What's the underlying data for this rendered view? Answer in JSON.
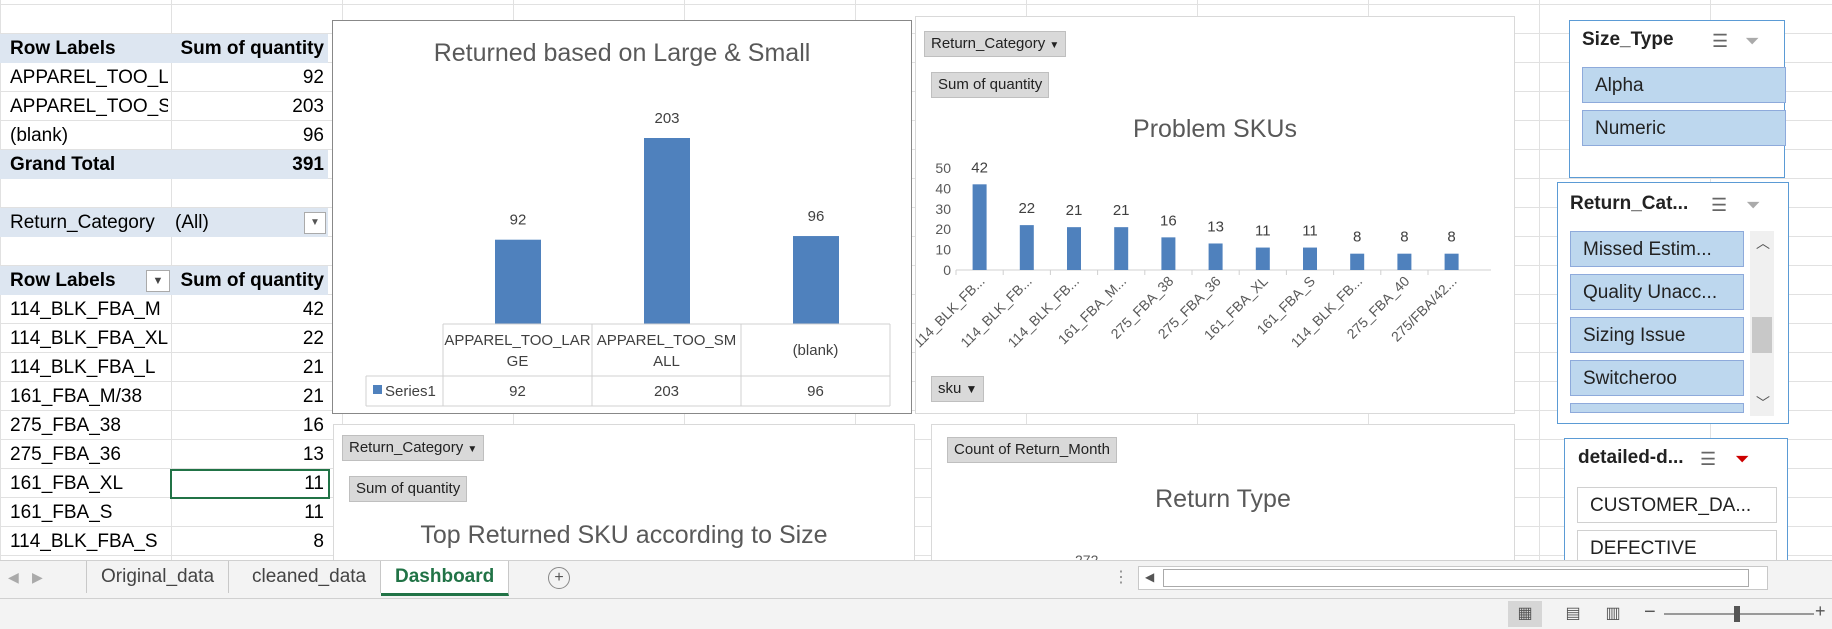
{
  "pivot1": {
    "headers": [
      "Row Labels",
      "Sum of quantity"
    ],
    "rows": [
      [
        "APPAREL_TOO_LARGE",
        "92"
      ],
      [
        "APPAREL_TOO_SMALL",
        "203"
      ],
      [
        "(blank)",
        "96"
      ]
    ],
    "total": [
      "Grand Total",
      "391"
    ]
  },
  "filter": {
    "label": "Return_Category",
    "value": "(All)"
  },
  "pivot2": {
    "headers": [
      "Row Labels",
      "Sum of quantity"
    ],
    "rows": [
      [
        "114_BLK_FBA_M",
        "42"
      ],
      [
        "114_BLK_FBA_XL",
        "22"
      ],
      [
        "114_BLK_FBA_L",
        "21"
      ],
      [
        "161_FBA_M/38",
        "21"
      ],
      [
        "275_FBA_38",
        "16"
      ],
      [
        "275_FBA_36",
        "13"
      ],
      [
        "161_FBA_XL",
        "11"
      ],
      [
        "161_FBA_S",
        "11"
      ],
      [
        "114_BLK_FBA_S",
        "8"
      ]
    ]
  },
  "chart1": {
    "title": "Returned based on Large & Small",
    "table_series": "Series1",
    "table_headers": [
      "APPAREL_TOO_LAR GE",
      "APPAREL_TOO_SM ALL",
      "(blank)"
    ],
    "color": "#4f81bd"
  },
  "chart2": {
    "title": "Problem SKUs",
    "filter_btn": "Return_Category",
    "values_btn": "Sum of quantity",
    "axis_btn": "sku",
    "yticks": [
      "50",
      "40",
      "30",
      "20",
      "10",
      "0"
    ],
    "color": "#4f81bd"
  },
  "chart3": {
    "title": "Top Returned SKU according to Size",
    "filter_btn": "Return_Category",
    "values_btn": "Sum of quantity"
  },
  "chart4": {
    "title": "Return Type",
    "values_btn": "Count of Return_Month",
    "partial_label": "272"
  },
  "slicer1": {
    "title": "Size_Type",
    "items": [
      "Alpha",
      "Numeric"
    ]
  },
  "slicer2": {
    "title": "Return_Cat...",
    "items": [
      "Missed Estim...",
      "Quality Unacc...",
      "Sizing Issue",
      "Switcheroo"
    ]
  },
  "slicer3": {
    "title": "detailed-d...",
    "items": [
      "CUSTOMER_DA...",
      "DEFECTIVE"
    ]
  },
  "tabs": [
    "Original_data",
    "cleaned_data",
    "Dashboard"
  ],
  "chart_data": [
    {
      "type": "bar",
      "title": "Returned based on Large & Small",
      "categories": [
        "APPAREL_TOO_LARGE",
        "APPAREL_TOO_SMALL",
        "(blank)"
      ],
      "series": [
        {
          "name": "Series1",
          "values": [
            92,
            203,
            96
          ]
        }
      ]
    },
    {
      "type": "bar",
      "title": "Problem SKUs",
      "categories": [
        "114_BLK_FB...",
        "114_BLK_FB...",
        "114_BLK_FB...",
        "161_FBA_M...",
        "275_FBA_38",
        "275_FBA_36",
        "161_FBA_XL",
        "161_FBA_S",
        "114_BLK_FB...",
        "275_FBA_40",
        "275/FBA/42..."
      ],
      "values": [
        42,
        22,
        21,
        21,
        16,
        13,
        11,
        11,
        8,
        8,
        8
      ],
      "ylim": [
        0,
        50
      ]
    }
  ]
}
